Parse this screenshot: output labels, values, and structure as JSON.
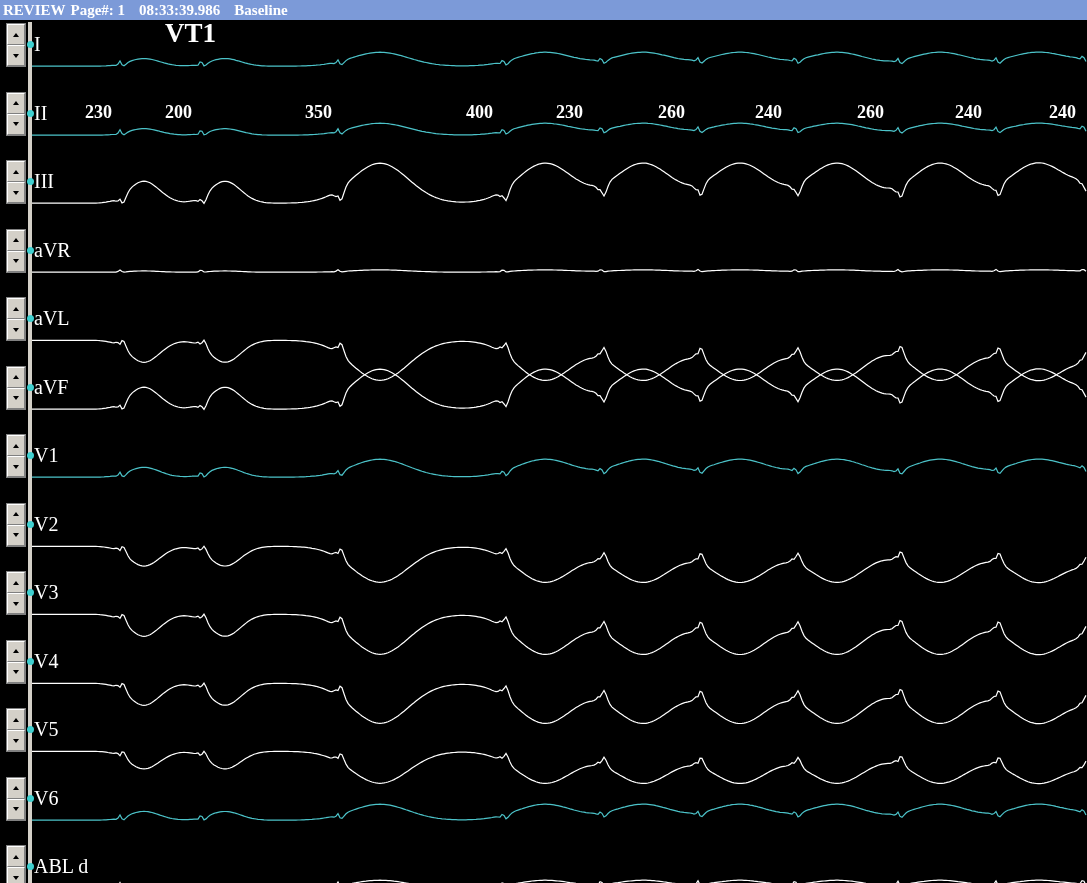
{
  "title_bar": {
    "mode": "REVIEW",
    "page": "Page#: 1",
    "time": "08:33:39.986",
    "label": "Baseline"
  },
  "rhythm_label": "VT1",
  "intervals": [
    "230",
    "200",
    "350",
    "400",
    "230",
    "260",
    "240",
    "260",
    "240",
    "240"
  ],
  "leads": [
    {
      "name": "I",
      "color": "#4cc3c9"
    },
    {
      "name": "II",
      "color": "#4cc3c9"
    },
    {
      "name": "III",
      "color": "#ffffff"
    },
    {
      "name": "aVR",
      "color": "#ffffff"
    },
    {
      "name": "aVL",
      "color": "#ffffff"
    },
    {
      "name": "aVF",
      "color": "#ffffff"
    },
    {
      "name": "V1",
      "color": "#4cc3c9"
    },
    {
      "name": "V2",
      "color": "#ffffff"
    },
    {
      "name": "V3",
      "color": "#ffffff"
    },
    {
      "name": "V4",
      "color": "#ffffff"
    },
    {
      "name": "V5",
      "color": "#ffffff"
    },
    {
      "name": "V6",
      "color": "#4cc3c9"
    },
    {
      "name": "ABL d",
      "color": "#ffffff"
    }
  ]
}
